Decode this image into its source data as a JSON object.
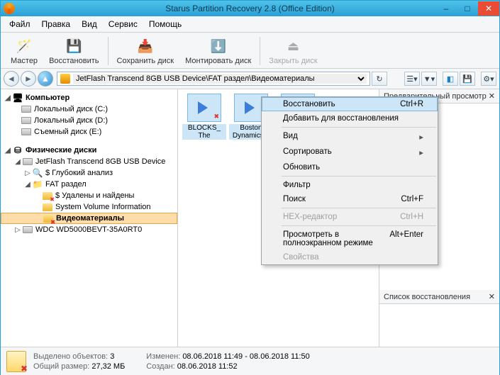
{
  "window": {
    "title": "Starus Partition Recovery 2.8 (Office Edition)"
  },
  "menu": [
    "Файл",
    "Правка",
    "Вид",
    "Сервис",
    "Помощь"
  ],
  "toolbar": [
    {
      "label": "Мастер"
    },
    {
      "label": "Восстановить"
    },
    {
      "label": "Сохранить диск"
    },
    {
      "label": "Монтировать диск"
    },
    {
      "label": "Закрыть диск"
    }
  ],
  "path": "JetFlash Transcend 8GB USB Device\\FAT раздел\\Видеоматериалы",
  "tree": {
    "computer": "Компьютер",
    "drives": [
      "Локальный диск (C:)",
      "Локальный диск (D:)",
      "Съемный диск (E:)"
    ],
    "phys_header": "Физические диски",
    "usb": "JetFlash Transcend 8GB USB Device",
    "deep": "$ Глубокий анализ",
    "fat": "FAT раздел",
    "delfound": "$ Удалены и найдены",
    "svi": "System Volume Information",
    "video": "Видеоматериалы",
    "wdc": "WDC WD5000BEVT-35A0RT0"
  },
  "files": [
    {
      "name": "BLOCKS_ The instrument ..."
    },
    {
      "name": "Boston Dynamics..."
    },
    {
      "name": ""
    }
  ],
  "rightpanel": {
    "preview": "Предварительный просмотр",
    "recovery_list": "Список восстановления"
  },
  "context_menu": {
    "restore": {
      "label": "Восстановить",
      "shortcut": "Ctrl+R"
    },
    "add": "Добавить для восстановления",
    "view": "Вид",
    "sort": "Сортировать",
    "refresh": "Обновить",
    "filter": "Фильтр",
    "search": {
      "label": "Поиск",
      "shortcut": "Ctrl+F"
    },
    "hex": {
      "label": "HEX-редактор",
      "shortcut": "Ctrl+H"
    },
    "fullscreen": {
      "label": "Просмотреть в полноэкранном режиме",
      "shortcut": "Alt+Enter"
    },
    "props": "Свойства"
  },
  "status": {
    "selected_label": "Выделено объектов:",
    "selected_count": "3",
    "size_label": "Общий размер:",
    "size_value": "27,32 МБ",
    "modified_label": "Изменен:",
    "modified_value": "08.06.2018 11:49 - 08.06.2018 11:50",
    "created_label": "Создан:",
    "created_value": "08.06.2018 11:52"
  }
}
